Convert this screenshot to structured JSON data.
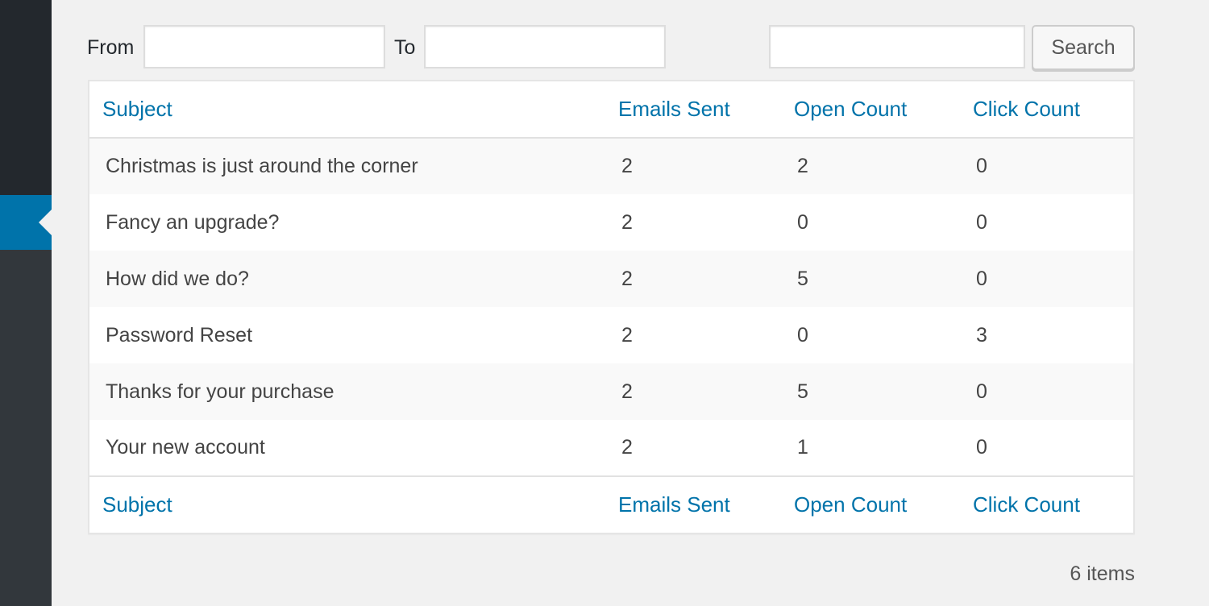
{
  "filters": {
    "from_label": "From",
    "from_value": "",
    "to_label": "To",
    "to_value": "",
    "search_value": "",
    "search_button": "Search"
  },
  "table": {
    "columns": [
      "Subject",
      "Emails Sent",
      "Open Count",
      "Click Count"
    ],
    "rows": [
      [
        "Christmas is just around the corner",
        "2",
        "2",
        "0"
      ],
      [
        "Fancy an upgrade?",
        "2",
        "0",
        "0"
      ],
      [
        "How did we do?",
        "2",
        "5",
        "0"
      ],
      [
        "Password Reset",
        "2",
        "0",
        "3"
      ],
      [
        "Thanks for your purchase",
        "2",
        "5",
        "0"
      ],
      [
        "Your new account",
        "2",
        "1",
        "0"
      ]
    ]
  },
  "pagination": {
    "count": "6 items"
  },
  "colors": {
    "accent": "#0073aa",
    "sidebar": "#32373c",
    "sidebar_top": "#23282d"
  }
}
